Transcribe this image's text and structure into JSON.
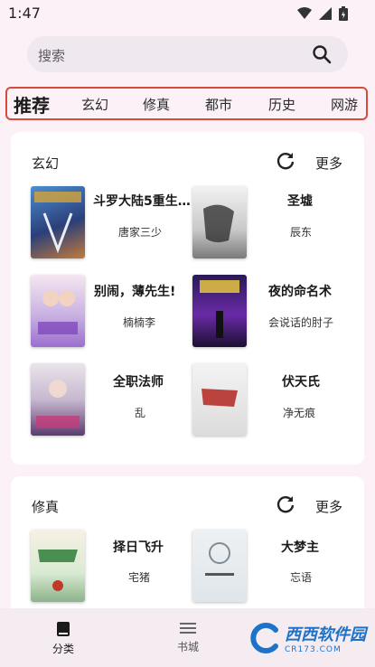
{
  "status": {
    "time": "1:47"
  },
  "search": {
    "placeholder": "搜索"
  },
  "tabs": [
    "推荐",
    "玄幻",
    "修真",
    "都市",
    "历史",
    "网游"
  ],
  "sections": [
    {
      "title": "玄幻",
      "more_label": "更多",
      "books": [
        {
          "title": "斗罗大陆5重生…",
          "author": "唐家三少"
        },
        {
          "title": "圣墟",
          "author": "辰东"
        },
        {
          "title": "别闹，薄先生!",
          "author": "楠楠李"
        },
        {
          "title": "夜的命名术",
          "author": "会说话的肘子"
        },
        {
          "title": "全职法师",
          "author": "乱"
        },
        {
          "title": "伏天氏",
          "author": "净无痕"
        }
      ]
    },
    {
      "title": "修真",
      "more_label": "更多",
      "books": [
        {
          "title": "择日飞升",
          "author": "宅猪"
        },
        {
          "title": "大梦主",
          "author": "忘语"
        }
      ]
    }
  ],
  "bottom_nav": [
    {
      "label": "分类",
      "icon": "book-icon"
    },
    {
      "label": "书城",
      "icon": "list-icon"
    }
  ],
  "colors": {
    "background": "#fbf1f6",
    "highlight_border": "#d94a3a",
    "card": "#ffffff"
  },
  "watermark": {
    "text": "西西软件园",
    "url_text": "CR173.COM"
  }
}
